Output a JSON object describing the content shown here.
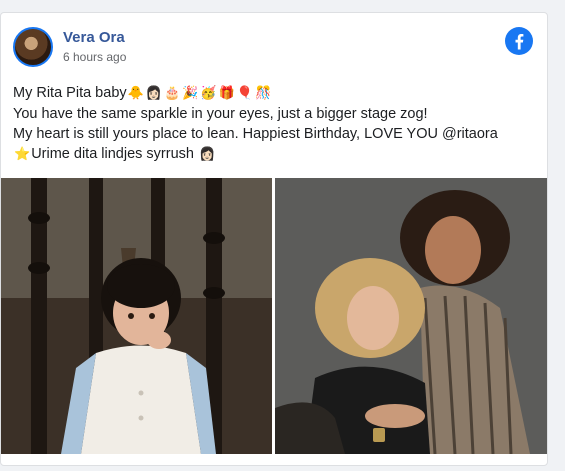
{
  "post": {
    "author": "Vera Ora",
    "time": "6 hours ago",
    "lines": [
      {
        "text": "My Rita Pita baby",
        "emojis": [
          "🐥",
          "👩🏻",
          "🎂",
          "🎉",
          "🥳",
          "🎁",
          "🎈",
          "🎊"
        ]
      },
      {
        "text": "You have the same sparkle in your eyes, just a bigger stage zog!",
        "emojis": []
      },
      {
        "text": "My heart is still yours place to lean. Happiest Birthday, LOVE YOU @ritaora",
        "emojis": []
      },
      {
        "text": "Urime dita lindjes syrrush",
        "lead_emoji": "⭐",
        "emojis": [
          "👩🏻"
        ]
      }
    ]
  },
  "icons": {
    "platform": "facebook-icon"
  },
  "colors": {
    "accent": "#1877f2",
    "author": "#365899"
  }
}
